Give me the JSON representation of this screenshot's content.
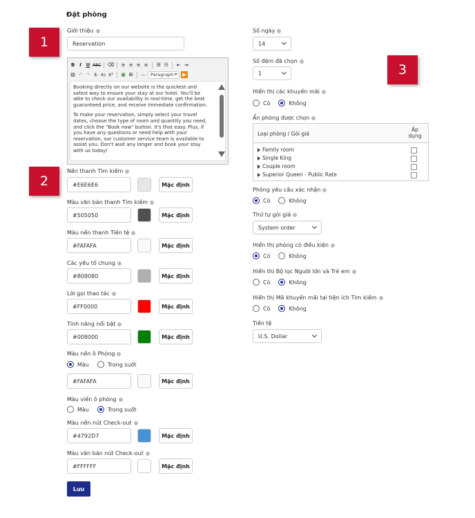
{
  "page_title": "Đặt phòng",
  "intro": {
    "label": "Giới thiệu",
    "value": "Reservation"
  },
  "editor": {
    "toolbar_row1": [
      "B",
      "I",
      "U",
      "ABC"
    ],
    "format_value": "Paragraph",
    "paragraphs": [
      "Booking directly on our website is the quickest and safest way to ensure your stay at our hotel. You'll be able to check our availability in real-time, get the best guaranteed price, and receive immediate confirmation.",
      "To make your reservation, simply select your travel dates, choose the type of room and quantity you need, and click the \"Book now\" button. It's that easy. Plus, if you have any questions or need help with your reservation, our customer service team is available to assist you. Don't wait any longer and book your stay with us today!"
    ]
  },
  "badges": [
    "1",
    "2",
    "3"
  ],
  "colors": [
    {
      "label": "Nền thanh Tìm kiếm",
      "value": "#E6E6E6",
      "swatch": "#E6E6E6",
      "button": "Mặc định"
    },
    {
      "label": "Màu văn bản thanh Tìm kiếm",
      "value": "#505050",
      "swatch": "#505050",
      "button": "Mặc định"
    },
    {
      "label": "Màu nền thanh Tiến tệ",
      "value": "#FAFAFA",
      "swatch": "#FAFAFA",
      "button": "Mặc định"
    },
    {
      "label": "Các yếu tố chung",
      "value": "#808080",
      "swatch": "#B0B0B0",
      "button": "Mặc định"
    },
    {
      "label": "Lời gọi thao tác",
      "value": "#FF0000",
      "swatch": "#FF0000",
      "button": "Mặc định"
    },
    {
      "label": "Tính năng nổi bật",
      "value": "#008000",
      "swatch": "#008000",
      "button": "Mặc định"
    }
  ],
  "room_bg": {
    "label": "Màu nền ô Phòng",
    "options": [
      "Màu",
      "Trong suốt"
    ],
    "selected": 0,
    "value": "#FAFAFA",
    "swatch": "#FAFAFA",
    "button": "Mặc định"
  },
  "room_border": {
    "label": "Màu viền ô phòng",
    "options": [
      "Màu",
      "Trong suốt"
    ],
    "selected": 1
  },
  "checkout_bg": {
    "label": "Màu nền nút Check-out",
    "value": "#4792D7",
    "swatch": "#4792D7",
    "button": "Mặc định"
  },
  "checkout_text": {
    "label": "Màu văn bản nút Check-out",
    "value": "#FFFFFF",
    "swatch": "#FFFFFF",
    "button": "Mặc định"
  },
  "save_label": "Lưu",
  "right": {
    "days": {
      "label": "Số ngày",
      "value": "14"
    },
    "nights": {
      "label": "Số đêm đã chọn",
      "value": "1"
    },
    "promos": {
      "label": "Hiển thị các khuyến mãi",
      "options": [
        "Có",
        "Không"
      ],
      "selected": 1
    },
    "hide_rooms": {
      "label": "Ẩn phòng được chọn",
      "col1": "Loại phòng / Gói giá",
      "col2_line1": "Áp",
      "col2_line2": "dụng",
      "rooms": [
        "Family room",
        "Single King",
        "Couple room",
        "Superior Queen - Public Rate"
      ]
    },
    "confirm": {
      "label": "Phòng yêu cầu xác nhận",
      "options": [
        "Có",
        "Không"
      ],
      "selected": 0
    },
    "order": {
      "label": "Thứ tự gói giá",
      "value": "System order"
    },
    "conditional": {
      "label": "Hiển thị phòng có điều kiện",
      "options": [
        "Có",
        "Không"
      ],
      "selected": 0
    },
    "adult_child": {
      "label": "Hiển thị Bộ lọc Người lớn và Trẻ em",
      "options": [
        "Có",
        "Không"
      ],
      "selected": 1
    },
    "promo_code": {
      "label": "Hiển thị Mã khuyến mãi tại tiện ích Tìm kiếm",
      "options": [
        "Có",
        "Không"
      ],
      "selected": 1
    },
    "currency": {
      "label": "Tiền tệ",
      "value": "U.S. Dollar"
    }
  }
}
